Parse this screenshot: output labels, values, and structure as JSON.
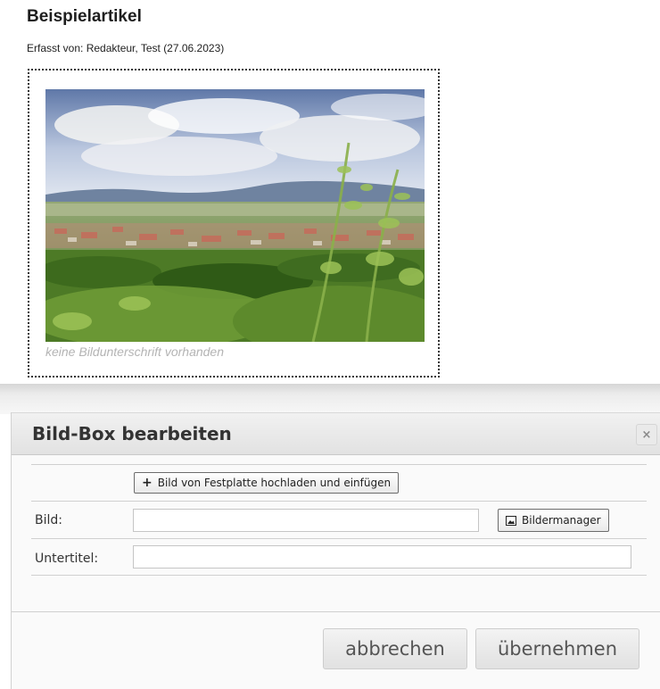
{
  "article": {
    "title": "Beispielartikel",
    "meta": "Erfasst von: Redakteur, Test (27.06.2023)",
    "caption_placeholder": "keine Bildunterschrift vorhanden"
  },
  "dialog": {
    "title": "Bild-Box bearbeiten",
    "close_symbol": "×",
    "upload_button": {
      "icon": "+",
      "label": "Bild von Festplatte hochladen und einfügen"
    },
    "image_row": {
      "label": "Bild:",
      "value": "",
      "manager_button": "Bildermanager"
    },
    "subtitle_row": {
      "label": "Untertitel:",
      "value": ""
    },
    "cancel_button": "abbrechen",
    "apply_button": "übernehmen"
  },
  "colors": {
    "dialog_header": "#e6e6e6",
    "caption": "#b4b4b4"
  },
  "icons": [
    "close-icon",
    "plus-icon",
    "image-icon"
  ]
}
